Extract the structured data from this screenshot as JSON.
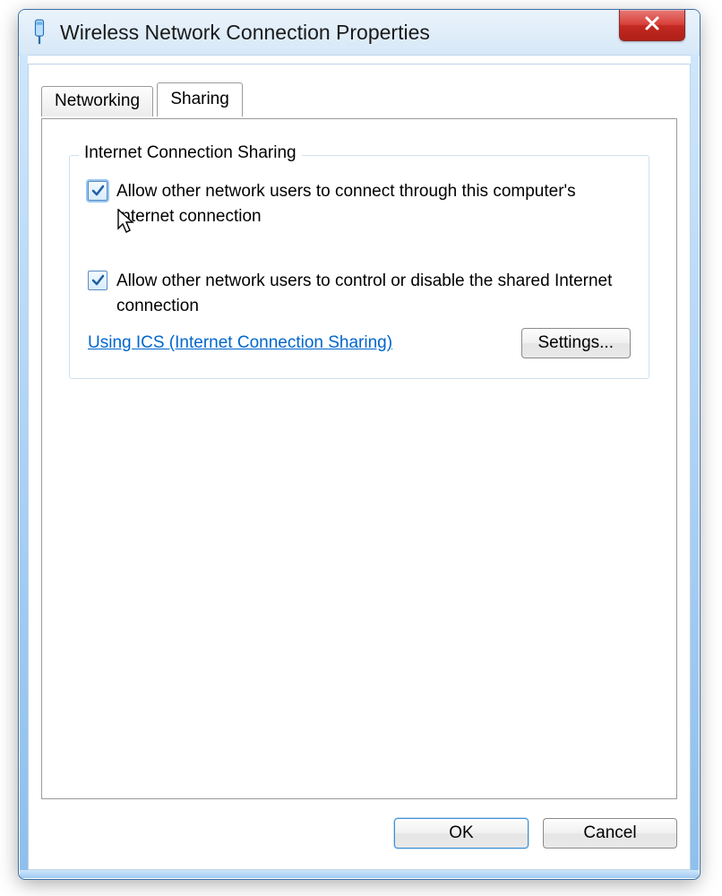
{
  "window": {
    "title": "Wireless Network Connection Properties",
    "icon": "network-adapter-icon"
  },
  "tabs": [
    {
      "label": "Networking",
      "active": false
    },
    {
      "label": "Sharing",
      "active": true
    }
  ],
  "group": {
    "legend": "Internet Connection Sharing",
    "options": [
      {
        "checked": true,
        "highlighted": true,
        "label": "Allow other network users to connect through this computer's Internet connection"
      },
      {
        "checked": true,
        "highlighted": false,
        "label": "Allow other network users to control or disable the shared Internet connection"
      }
    ],
    "link": "Using ICS (Internet Connection Sharing)",
    "settings_button": "Settings..."
  },
  "footer": {
    "ok": "OK",
    "cancel": "Cancel"
  }
}
